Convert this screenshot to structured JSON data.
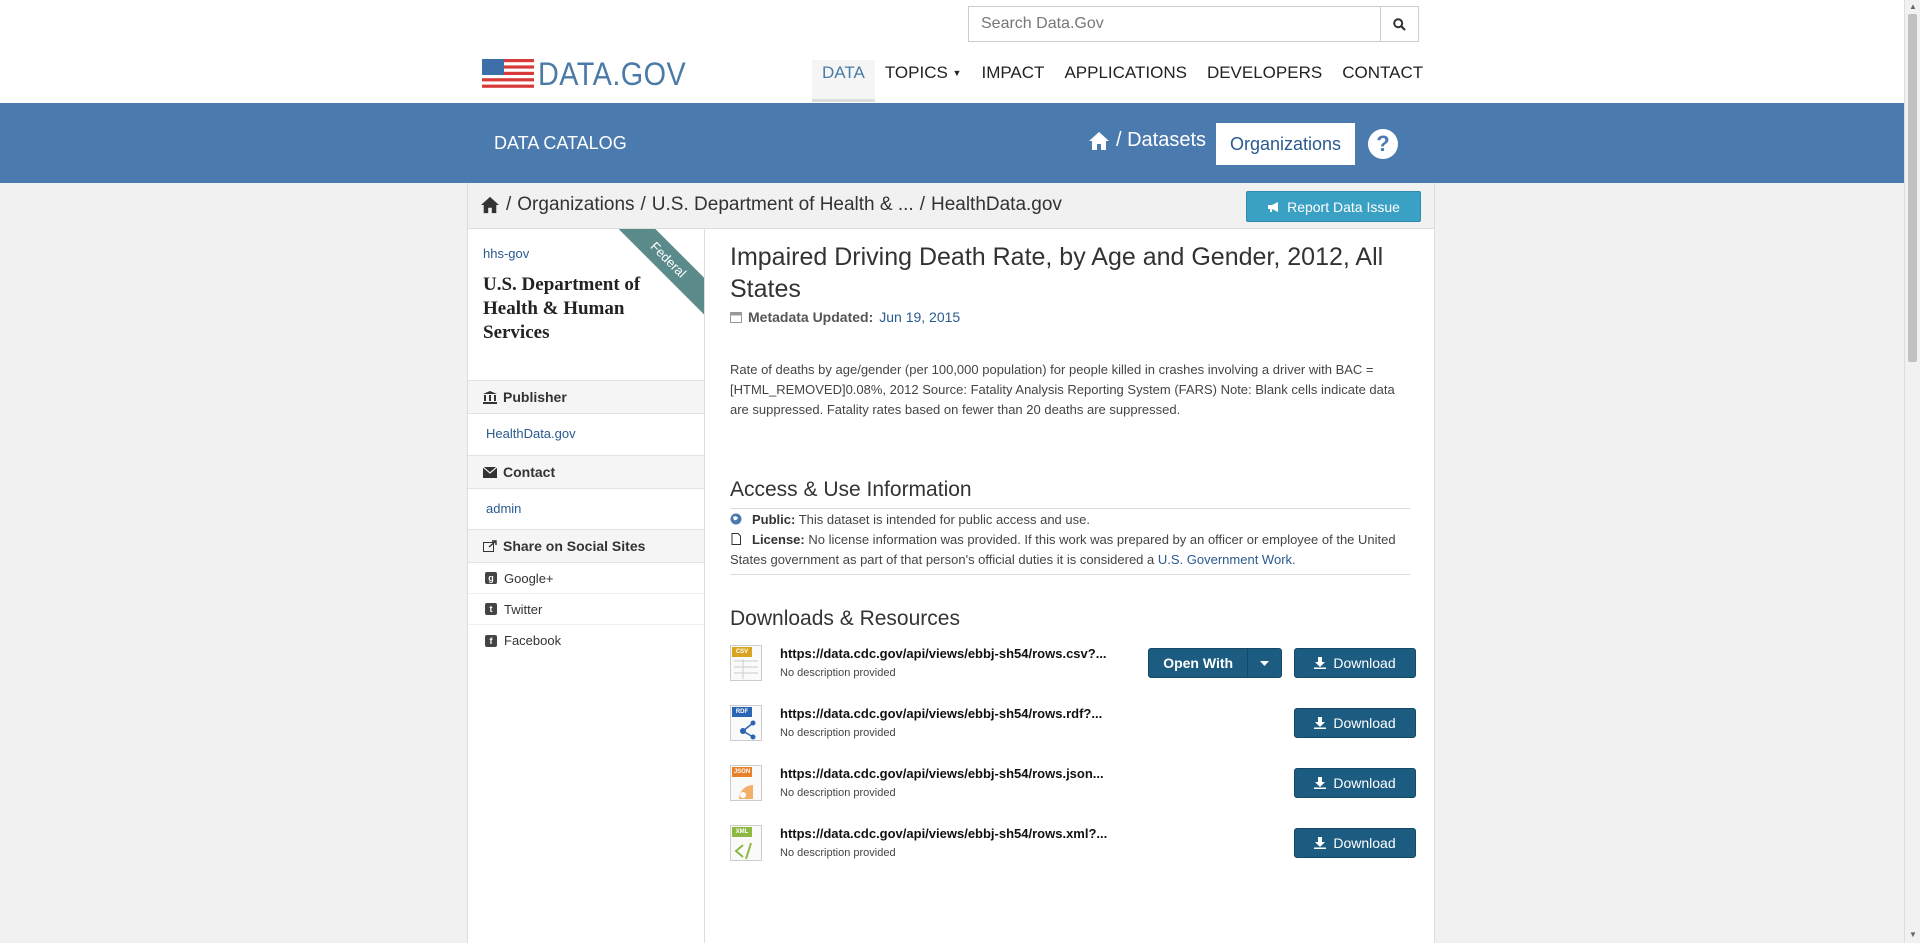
{
  "search": {
    "placeholder": "Search Data.Gov"
  },
  "logo": {
    "text": "DATA.GOV"
  },
  "nav": [
    {
      "label": "DATA"
    },
    {
      "label": "TOPICS"
    },
    {
      "label": "IMPACT"
    },
    {
      "label": "APPLICATIONS"
    },
    {
      "label": "DEVELOPERS"
    },
    {
      "label": "CONTACT"
    }
  ],
  "band": {
    "title": "DATA CATALOG",
    "datasets_label": "/ Datasets",
    "organizations_label": "Organizations",
    "help": "?"
  },
  "breadcrumb": {
    "separator": "/",
    "items": [
      "Organizations",
      "U.S. Department of Health & ...",
      "HealthData.gov"
    ]
  },
  "report_button": "Report Data Issue",
  "sidebar": {
    "ribbon": "Federal",
    "org_slug": "hhs-gov",
    "org_name": "U.S. Department of Health & Human Services",
    "publisher_label": "Publisher",
    "publisher_value": "HealthData.gov",
    "contact_label": "Contact",
    "contact_value": "admin",
    "share_label": "Share on Social Sites",
    "social": [
      "Google+",
      "Twitter",
      "Facebook"
    ]
  },
  "dataset": {
    "title": "Impaired Driving Death Rate, by Age and Gender, 2012, All States",
    "metadata_label": "Metadata Updated:",
    "metadata_date": "Jun 19, 2015",
    "description": "Rate of deaths by age/gender (per 100,000 population) for people killed in crashes involving a driver with BAC =[HTML_REMOVED]0.08%, 2012 Source: Fatality Analysis Reporting System (FARS) Note: Blank cells indicate data are suppressed. Fatality rates based on fewer than 20 deaths are suppressed."
  },
  "access": {
    "heading": "Access & Use Information",
    "public_label": "Public:",
    "public_text": "This dataset is intended for public access and use.",
    "license_label": "License:",
    "license_text": "No license information was provided. If this work was prepared by an officer or employee of the United States government as part of that person's official duties it is considered a",
    "license_link": "U.S. Government Work."
  },
  "downloads": {
    "heading": "Downloads & Resources",
    "open_with": "Open With",
    "download_label": "Download",
    "resources": [
      {
        "format": "CSV",
        "color": "#d9a521",
        "url": "https://data.cdc.gov/api/views/ebbj-sh54/rows.csv?...",
        "desc": "No description provided"
      },
      {
        "format": "RDF",
        "color": "#2a64b3",
        "url": "https://data.cdc.gov/api/views/ebbj-sh54/rows.rdf?...",
        "desc": "No description provided"
      },
      {
        "format": "JSON",
        "color": "#e8812a",
        "url": "https://data.cdc.gov/api/views/ebbj-sh54/rows.json...",
        "desc": "No description provided"
      },
      {
        "format": "XML",
        "color": "#8cb843",
        "url": "https://data.cdc.gov/api/views/ebbj-sh54/rows.xml?...",
        "desc": "No description provided"
      }
    ]
  }
}
